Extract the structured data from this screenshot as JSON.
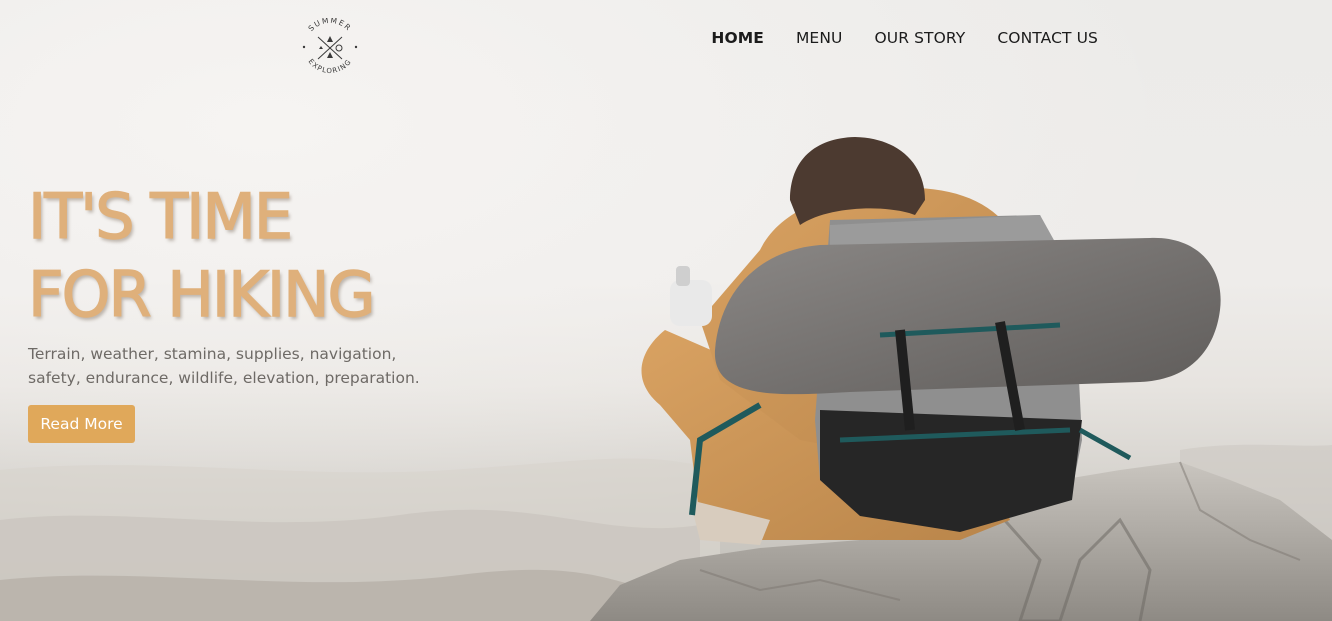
{
  "brand": {
    "logo_top": "SUMMER",
    "logo_bottom": "EXPLORING",
    "logo_icon": "compass-crossed-arrows-icon"
  },
  "nav": {
    "items": [
      {
        "label": "HOME",
        "active": true
      },
      {
        "label": "MENU",
        "active": false
      },
      {
        "label": "OUR STORY",
        "active": false
      },
      {
        "label": "CONTACT US",
        "active": false
      }
    ]
  },
  "hero": {
    "headline_line1": "IT'S TIME",
    "headline_line2": "FOR HIKING",
    "tagline_line1": "Terrain, weather, stamina, supplies, navigation,",
    "tagline_line2": "safety, endurance, wildlife, elevation, preparation.",
    "cta_label": "Read More",
    "image_subject": "hiker-with-backpack-on-rock-photo"
  },
  "colors": {
    "headline": "#dfb07b",
    "cta_background": "#e0a85a",
    "cta_text": "#ffffff",
    "nav_text": "#1c1c1c",
    "tagline_text": "#6e6a66"
  }
}
